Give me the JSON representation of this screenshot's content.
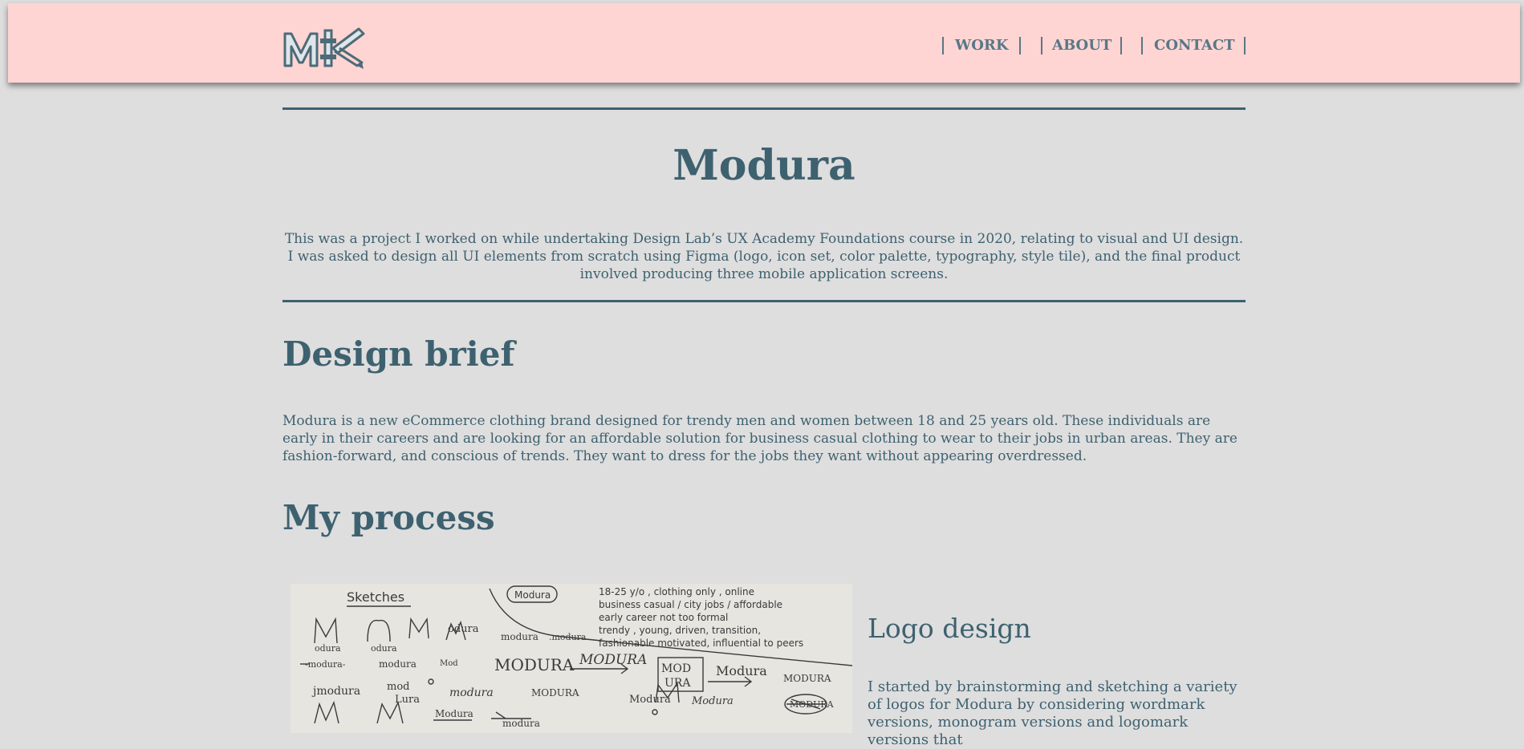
{
  "nav": {
    "logo_alt": "MK",
    "links": [
      {
        "label": "WORK"
      },
      {
        "label": "ABOUT"
      },
      {
        "label": "CONTACT"
      }
    ]
  },
  "project": {
    "title": "Modura",
    "intro": "This was a project I worked on while undertaking Design Lab’s UX Academy Foundations course in 2020, relating to visual and UI design. I was asked to design all UI elements from scratch using Figma (logo, icon set, color palette, typography, style tile), and the final product involved producing three mobile application screens."
  },
  "brief": {
    "heading": "Design brief",
    "text": "Modura is a new eCommerce clothing brand designed for trendy men and women between 18 and 25 years old. These individuals are early in their careers and are looking for an affordable solution for business casual clothing to wear to their jobs in urban areas. They are fashion-forward, and conscious of trends. They want to dress for the jobs they want without appearing overdressed."
  },
  "process": {
    "heading": "My process",
    "image_text": {
      "sketches_label": "Sketches",
      "brand_box": "Modura",
      "notes": [
        "18-25 y/o , clothing only , online",
        "business casual / city jobs / affordable",
        "early career    not too formal",
        "trendy , young, driven, transition,",
        "fashionable    motivated, influential to peers"
      ]
    },
    "logo_design": {
      "heading": "Logo design",
      "text": "I started by brainstorming and sketching a variety of logos for Modura by considering wordmark versions, monogram versions and logomark versions that"
    }
  },
  "colors": {
    "background": "#dedede",
    "navbar": "#ffd5d3",
    "primary_text": "#3e6170",
    "nav_text": "#597787"
  }
}
